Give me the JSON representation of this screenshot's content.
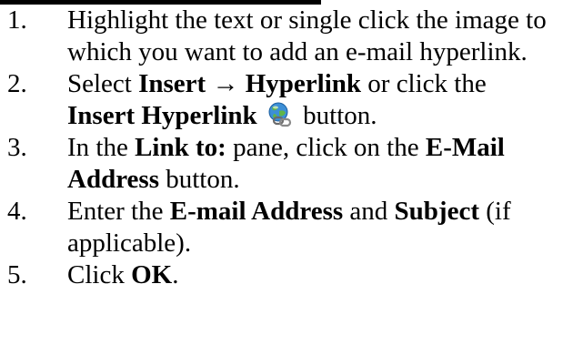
{
  "steps": [
    {
      "number": "1.",
      "text": "Highlight the text or single click the image to which you want to add an e-mail hyperlink."
    },
    {
      "number": "2.",
      "part1": "Select ",
      "insert": "Insert",
      "arrow": "→",
      "hyperlink": "Hyperlink",
      "part2": " or click the",
      "button_name": "Insert Hyperlink",
      "icon": "insert-hyperlink-globe-icon",
      "part3": " button."
    },
    {
      "number": "3.",
      "part1": "In the ",
      "link_to": "Link to:",
      "part2": " pane, click on the ",
      "email_address": "E-Mail Address",
      "part3": " button."
    },
    {
      "number": "4.",
      "part1": "Enter the ",
      "email_field": "E-mail Address",
      "part2": " and ",
      "subject": "Subject",
      "part3": " (if applicable)."
    },
    {
      "number": "5.",
      "part1": "Click ",
      "ok": "OK",
      "part2": "."
    }
  ]
}
